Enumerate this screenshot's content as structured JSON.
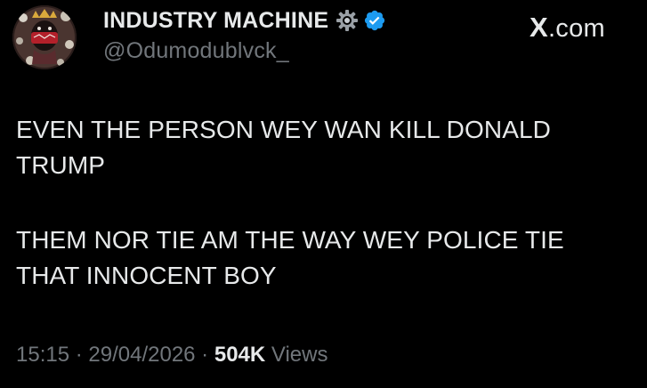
{
  "author": {
    "display_name": "INDUSTRY MACHINE",
    "handle": "@Odumodublvck_",
    "badge_icon": "gear-icon",
    "verified_icon": "verified-badge-icon",
    "verified_color": "#1d9bf0"
  },
  "watermark": {
    "glyph": "X",
    "suffix": ".com"
  },
  "tweet": {
    "paragraph_1": "EVEN THE PERSON WEY WAN KILL DONALD TRUMP",
    "paragraph_2": "THEM NOR TIE AM THE WAY WEY POLICE TIE THAT INNOCENT BOY"
  },
  "meta": {
    "time": "15:15",
    "separator": " · ",
    "date": "29/04/2026",
    "views_count": "504K",
    "views_label": " Views"
  },
  "colors": {
    "background": "#000000",
    "primary_text": "#e7e9ea",
    "secondary_text": "#71767b"
  }
}
